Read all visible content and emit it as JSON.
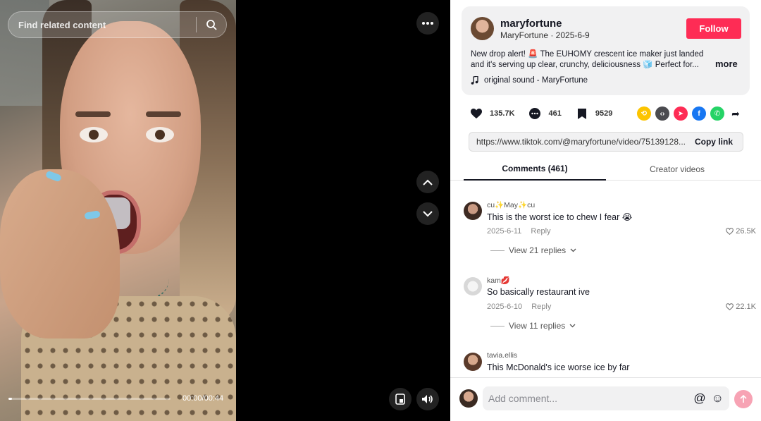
{
  "video": {
    "search_placeholder": "Find related content",
    "time": "00:00/00:44",
    "progress": 0.02
  },
  "creator": {
    "username": "maryfortune",
    "subline": "MaryFortune · 2025-6-9",
    "follow_label": "Follow",
    "caption": "New drop alert! 🚨 The EUHOMY crescent ice maker just landed and it's serving up clear, crunchy, deliciousness 🧊 Perfect for...",
    "more_label": "more",
    "sound": "original sound - MaryFortune"
  },
  "stats": {
    "likes": "135.7K",
    "comments": "461",
    "saves": "9529"
  },
  "share": {
    "url": "https://www.tiktok.com/@maryfortune/video/75139128...",
    "copy_label": "Copy link"
  },
  "tabs": {
    "comments": "Comments (461)",
    "creator": "Creator videos"
  },
  "comments": [
    {
      "user": "cu✨May✨cu",
      "text": "This is the worst ice to chew I fear 😭",
      "date": "2025-6-11",
      "reply": "Reply",
      "likes": "26.5K",
      "replies": "View 21 replies"
    },
    {
      "user": "kam💋",
      "text": "So basically restaurant ive",
      "date": "2025-6-10",
      "reply": "Reply",
      "likes": "22.1K",
      "replies": "View 11 replies"
    },
    {
      "user": "tavia.ellis",
      "text": "This McDonald's ice worse ice by far"
    }
  ],
  "composer": {
    "placeholder": "Add comment...",
    "mention": "@",
    "emoji": "☺"
  },
  "colors": {
    "accent": "#fe2c55"
  }
}
